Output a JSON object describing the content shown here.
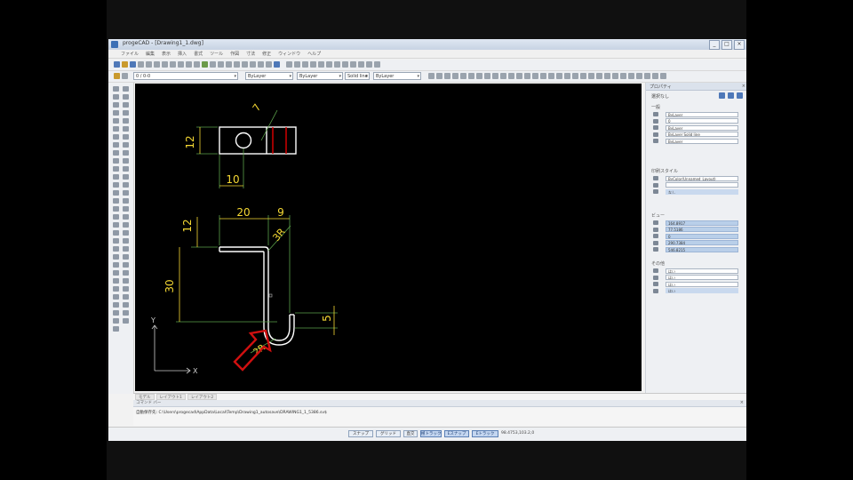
{
  "window": {
    "title": "progeCAD - [Drawing1_1.dwg]",
    "buttons": [
      "_",
      "□",
      "×"
    ]
  },
  "menu": [
    "ファイル",
    "編集",
    "表示",
    "挿入",
    "書式",
    "ツール",
    "作図",
    "寸法",
    "修正",
    "ウィンドウ",
    "ヘルプ"
  ],
  "toolbar2": {
    "layer_combo": "0 / 0-0",
    "color_combo": "ByLayer",
    "linetype_combo": "ByLayer",
    "lineweight_combo": "Solid line",
    "linestyle_combo": "ByLayer"
  },
  "properties": {
    "panel_title": "プロパティ",
    "close": "×",
    "selection_label": "選択なし",
    "general_title": "一般",
    "general_rows": [
      "ByLayer",
      "0",
      "ByLayer",
      "ByLayer    Solid line",
      "ByLayer"
    ],
    "style_title": "印刷スタイル",
    "style_rows": [
      "ByColor(Unnamed_Layout)",
      "",
      "なし"
    ],
    "view_title": "ビュー",
    "view_rows": [
      "164.8917",
      "77.5186",
      "0",
      "290.7384",
      "546.8215"
    ],
    "misc_title": "その他",
    "misc_rows": [
      "はい",
      "はい",
      "はい",
      "はい"
    ]
  },
  "drawing": {
    "top_view_dims": {
      "height": "12",
      "leader": "7",
      "width": "10"
    },
    "side_view_dims": {
      "vertical_top": "12",
      "horizontal_a": "20",
      "horizontal_b": "9",
      "angle": "3R",
      "vertical_main": "30",
      "hook": "5",
      "radius": "2R"
    },
    "ucs_x": "X",
    "ucs_y": "Y"
  },
  "command": {
    "tabs": [
      "モデル",
      "レイアウト1",
      "レイアウト2"
    ],
    "header": "コマンド バー",
    "close": "×",
    "history": "自動保存先: C:\\Users\\progecad\\AppData\\Local\\Temp\\Drawing1_autosave\\DRAWING1_1_5386.sv$"
  },
  "status": {
    "modes": [
      "スナップ",
      "グリッド",
      "直交",
      "極トラック",
      "Eスナップ",
      "Eトラック"
    ],
    "active_modes": [
      3,
      4,
      5
    ],
    "coordinates": "98.4753,103.2,0"
  },
  "colors": {
    "canvas": "#000000",
    "entity": "#ffffff",
    "dimension": "#f5d833",
    "extension": "#5aa04a",
    "red_entity": "#e00000",
    "arrow": "#d01010"
  }
}
